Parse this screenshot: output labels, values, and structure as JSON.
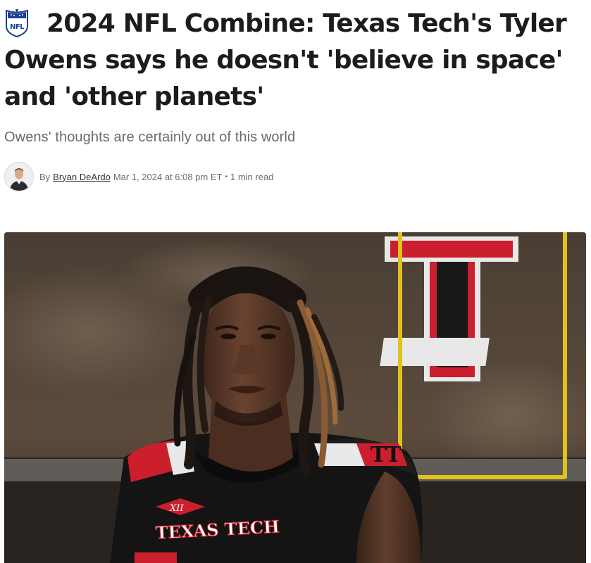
{
  "article": {
    "headline": "2024 NFL Combine: Texas Tech's Tyler Owens says he doesn't 'believe in space' and 'other planets'",
    "dek": "Owens' thoughts are certainly out of this world",
    "byline": {
      "prefix": "By",
      "author": "Bryan DeArdo",
      "date": "Mar 1, 2024 at 6:08 pm ET",
      "separator": "•",
      "read_time": "1 min read"
    }
  },
  "logo": {
    "text": "NFL",
    "icon": "nfl-shield-icon"
  },
  "hero_image": {
    "jersey_text": "TEXAS TECH",
    "colors": {
      "red": "#cc1f2d",
      "black": "#111111",
      "goalpost": "#e0c21a"
    }
  }
}
